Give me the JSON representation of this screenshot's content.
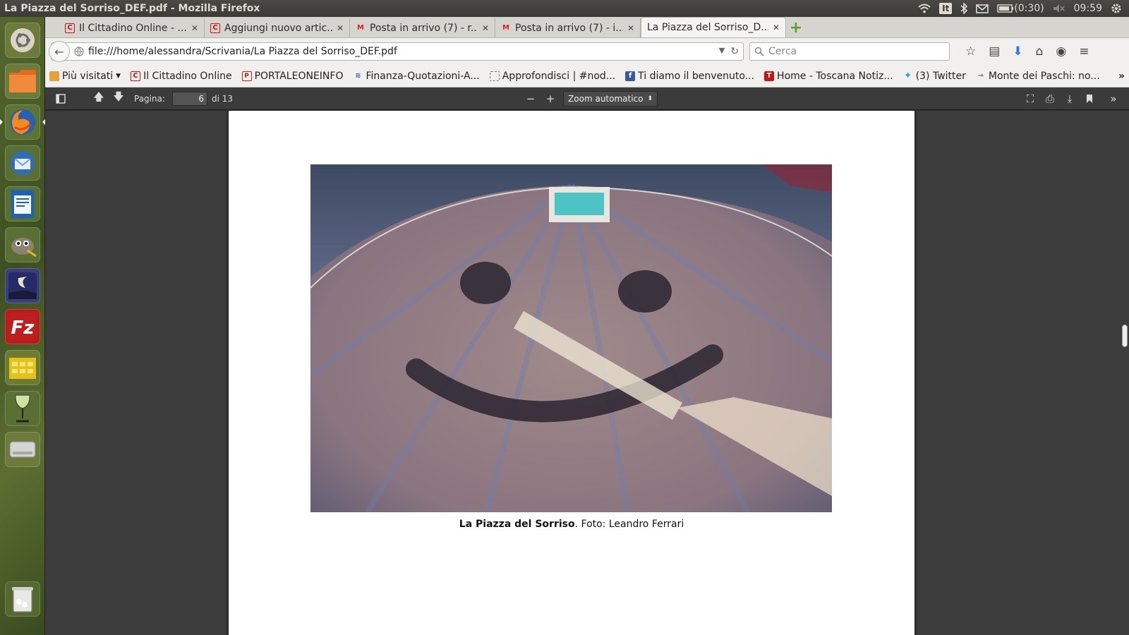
{
  "topbar": {
    "window_title": "La Piazza del Sorriso_DEF.pdf - Mozilla Firefox",
    "keyboard": "It",
    "battery": "(0:30)",
    "clock": "09:59"
  },
  "tabs": [
    {
      "label": "Il Cittadino Online - ..."
    },
    {
      "label": "Aggiungi nuovo artic..."
    },
    {
      "label": "Posta in arrivo (7) - r..."
    },
    {
      "label": "Posta in arrivo (7) - i..."
    },
    {
      "label": "La Piazza del Sorriso_D..."
    }
  ],
  "navbar": {
    "url": "file:///home/alessandra/Scrivania/La Piazza del Sorriso_DEF.pdf",
    "search_placeholder": "Cerca"
  },
  "bookmarks": [
    {
      "label": "Più visitati"
    },
    {
      "label": "Il Cittadino Online"
    },
    {
      "label": "PORTALEONEINFO"
    },
    {
      "label": "Finanza-Quotazioni-A..."
    },
    {
      "label": "Approfondisci | #nod..."
    },
    {
      "label": "Ti diamo il benvenuto..."
    },
    {
      "label": "Home - Toscana Notiz..."
    },
    {
      "label": "(3) Twitter"
    },
    {
      "label": "Monte dei Paschi: no..."
    }
  ],
  "pdf_toolbar": {
    "page_label": "Pagina:",
    "page_value": "6",
    "page_total": "di 13",
    "zoom_value": "Zoom automatico"
  },
  "document": {
    "caption_bold": "La Piazza del Sorriso",
    "caption_rest": ". Foto: Leandro Ferrari"
  }
}
